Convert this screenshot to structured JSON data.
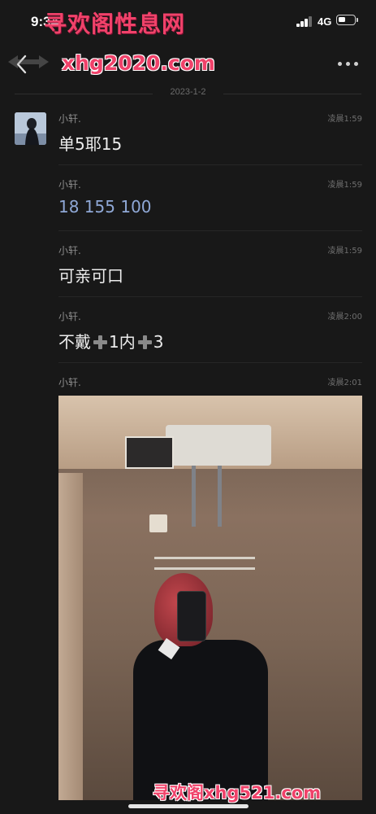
{
  "status_bar": {
    "time": "9:34",
    "network": "4G",
    "battery_level": 0.45
  },
  "watermarks": {
    "top": "寻欢阁性息网",
    "domain": "xhg2020.com",
    "bottom": "寻欢阁xhg521.com"
  },
  "chat": {
    "date": "2023-1-2",
    "messages": [
      {
        "sender": "小轩.",
        "time": "凌晨1:59",
        "text": "单5耶15"
      },
      {
        "sender": "小轩.",
        "time": "凌晨1:59",
        "text": "18 155 100"
      },
      {
        "sender": "小轩.",
        "time": "凌晨1:59",
        "text": "可亲可口"
      },
      {
        "sender": "小轩.",
        "time": "凌晨2:00",
        "text_parts": [
          "不戴",
          "1内",
          "3"
        ]
      },
      {
        "sender": "小轩.",
        "time": "凌晨2:01"
      }
    ]
  },
  "colors": {
    "background": "#181818",
    "watermark": "#f0426a",
    "link_text": "#8fa8d6"
  }
}
